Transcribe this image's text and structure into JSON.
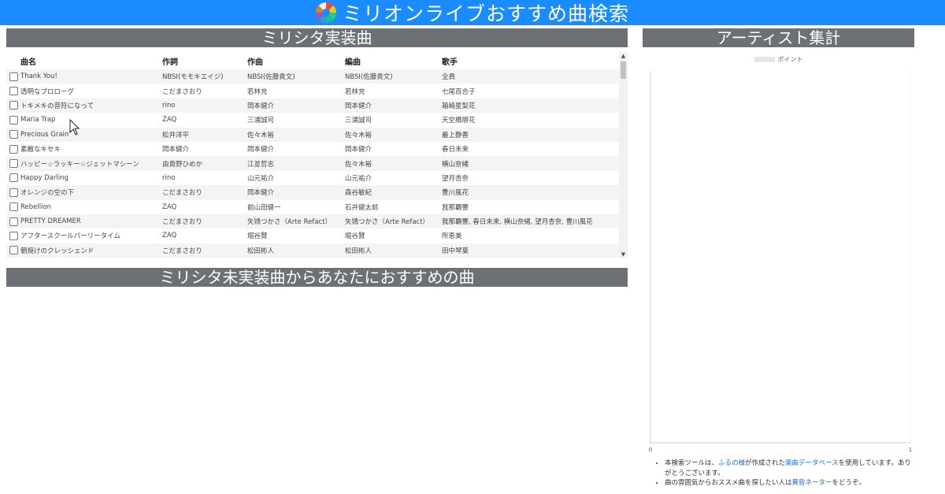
{
  "header": {
    "title": "ミリオンライブおすすめ曲検索",
    "icon": "colorful-ring-logo"
  },
  "sections": {
    "implemented": "ミリシタ実装曲",
    "artist": "アーティスト集計",
    "recommend": "ミリシタ未実装曲からあなたにおすすめの曲"
  },
  "table": {
    "columns": [
      "曲名",
      "作詞",
      "作曲",
      "編曲",
      "歌手"
    ],
    "rows": [
      [
        "Thank You!",
        "NBSI(モモキエイジ)",
        "NBSI(佐藤貴文)",
        "NBSI(佐藤貴文)",
        "全員"
      ],
      [
        "透明なプロローグ",
        "こだまさおり",
        "若林充",
        "若林充",
        "七尾百合子"
      ],
      [
        "トキメキの音符になって",
        "rino",
        "岡本健介",
        "岡本健介",
        "箱崎星梨花"
      ],
      [
        "Maria Trap",
        "ZAQ",
        "三浦誠司",
        "三浦誠司",
        "天空橋朋花"
      ],
      [
        "Precious Grain",
        "松井洋平",
        "佐々木裕",
        "佐々木裕",
        "最上静香"
      ],
      [
        "素敵なキセキ",
        "岡本健介",
        "岡本健介",
        "岡本健介",
        "春日未来"
      ],
      [
        "ハッピー☆ラッキー☆ジェットマシーン",
        "由貴野ひめか",
        "江並哲志",
        "佐々木裕",
        "横山奈緒"
      ],
      [
        "Happy Darling",
        "rino",
        "山元祐介",
        "山元祐介",
        "望月杏奈"
      ],
      [
        "オレンジの空の下",
        "こだまさおり",
        "岡本健介",
        "森谷敏紀",
        "豊川風花"
      ],
      [
        "Rebellion",
        "ZAQ",
        "前山田健一",
        "石井健太郎",
        "我那覇響"
      ],
      [
        "PRETTY DREAMER",
        "こだまさおり",
        "矢鴇つかさ（Arte Refact）",
        "矢鴇つかさ（Arte Refact）",
        "我那覇響, 春日未来, 横山奈緒, 望月杏奈, 豊川風花"
      ],
      [
        "アフタースクールパーリータイム",
        "ZAQ",
        "堀谷賢",
        "堀谷賢",
        "所恵美"
      ],
      [
        "朝焼けのクレッシェンド",
        "こだまさおり",
        "松田彬人",
        "松田彬人",
        "田中琴葉"
      ]
    ]
  },
  "chart_data": {
    "type": "bar",
    "legend_label": "ポイント",
    "categories": [],
    "values": [],
    "xlim": [
      0,
      1
    ],
    "xticks": [
      "0",
      "1"
    ]
  },
  "notes": [
    {
      "pre": "本検索ツールは、",
      "link1": "ふるの様",
      "mid": "が作成された",
      "link2": "楽曲データベース",
      "post": "を使用しています。ありがとうございます。"
    },
    {
      "pre": "曲の雰囲気からおススメ曲を探したい人は",
      "link1": "黄昏ネーター",
      "post": "をどうぞ。"
    }
  ],
  "colors": {
    "accent": "#1a8cff",
    "header_gray": "#6c7175"
  }
}
